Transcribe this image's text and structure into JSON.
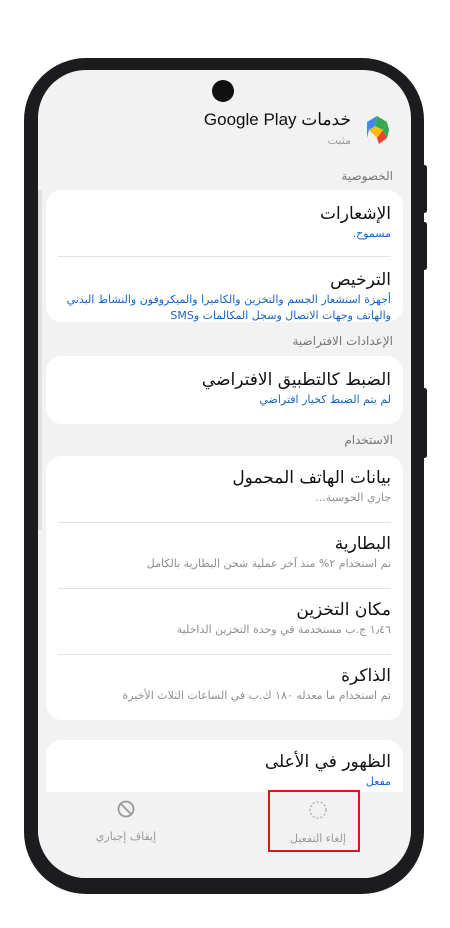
{
  "app": {
    "title": "خدمات Google Play",
    "subtitle": "مثبت",
    "icon": "google-play-services-icon"
  },
  "sections": {
    "privacy": "الخصوصية",
    "defaults": "الإعدادات الافتراضية",
    "usage": "الاستخدام"
  },
  "rows": {
    "notifications": {
      "title": "الإشعارات",
      "sub": "مسموح."
    },
    "permissions": {
      "title": "الترخيص",
      "sub": "أجهزة استشعار الجسم والتخزين والكاميرا والميكروفون والنشاط البدني والهاتف وجهات الاتصال وسجل المكالمات وSMS"
    },
    "default_app": {
      "title": "الضبط كالتطبيق الافتراضي",
      "sub": "لم يتم الضبط كخيار افتراضي"
    },
    "mobile_data": {
      "title": "بيانات الهاتف المحمول",
      "sub": "جاري الحوسبة..."
    },
    "battery": {
      "title": "البطارية",
      "sub": "تم استخدام ٢% منذ آخر عملية شحن البطارية بالكامل"
    },
    "storage": {
      "title": "مكان التخزين",
      "sub": "١٫٤٦ ج.ب مستخدمة في وحدة التخزين الداخلية"
    },
    "memory": {
      "title": "الذاكرة",
      "sub": "تم استخدام ما معدله ١٨٠ ك.ب في الساعات الثلاث الأخيرة"
    },
    "appear_on_top": {
      "title": "الظهور في الأعلى",
      "sub": "مفعل"
    }
  },
  "bottom_actions": {
    "disable": {
      "label": "إلغاء التفعيل",
      "icon": "disable-circle-icon"
    },
    "force_stop": {
      "label": "إيقاف إجباري",
      "icon": "force-stop-icon"
    }
  },
  "colors": {
    "accent": "#1565c0",
    "highlight": "#d01c1c"
  }
}
